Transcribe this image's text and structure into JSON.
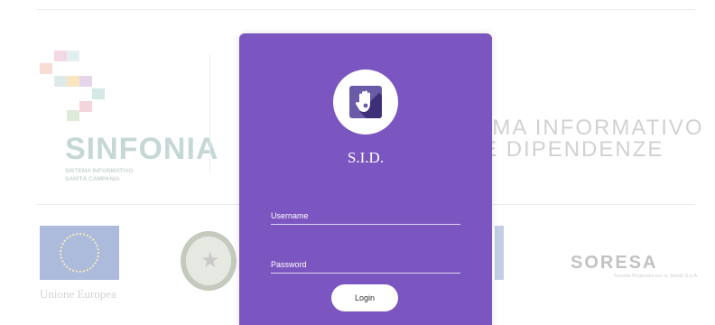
{
  "background": {
    "sinfonia": {
      "brand": "SINFONIA",
      "subtitle_line1": "SISTEMA INFORMATIVO",
      "subtitle_line2": "SANITÀ CAMPANIA"
    },
    "sid_title_line1": "SISTEMA INFORMATIVO",
    "sid_title_line2": "DELLE DIPENDENZE",
    "eu_label": "Unione Europea",
    "soresa_brand": "SORESA",
    "soresa_sub": "Società Regionale per la Sanità S.p.A."
  },
  "login": {
    "title": "S.I.D.",
    "username_placeholder": "Username",
    "password_placeholder": "Password",
    "button_label": "Login",
    "icon": "hand-stop-icon"
  },
  "colors": {
    "card": "#7b56c0",
    "icon_bg": "#6a5aa8",
    "icon_stripe": "#3f2f78",
    "sinfonia_text": "#7fa7a6"
  }
}
